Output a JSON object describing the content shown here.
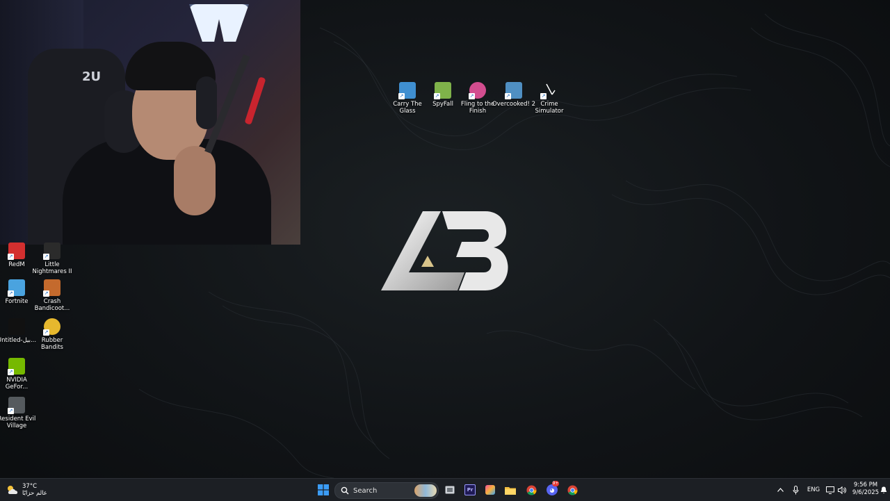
{
  "desktop": {
    "top_icons": [
      {
        "label": "Carry The Glass",
        "icon": "carry-the-glass-icon",
        "color": "#3f8fd1"
      },
      {
        "label": "SpyFall",
        "icon": "spyfall-icon",
        "color": "#7fb24a"
      },
      {
        "label": "Fling to the Finish",
        "icon": "fling-to-the-finish-icon",
        "color": "#d24d8f"
      },
      {
        "label": "Overcooked! 2",
        "icon": "overcooked-2-icon",
        "color": "#4f8fc2"
      },
      {
        "label": "Crime Simulator",
        "icon": "crime-simulator-icon",
        "color": "#1b1b1b"
      }
    ],
    "left_icons": [
      {
        "label": "RedM",
        "icon": "redm-icon",
        "color": "#d32f2f"
      },
      {
        "label": "Little Nightmares II",
        "icon": "little-nightmares-icon",
        "color": "#2b2b2b"
      },
      {
        "label": "Fortnite",
        "icon": "fortnite-icon",
        "color": "#4aa3df"
      },
      {
        "label": "Crash Bandicoot...",
        "icon": "crash-bandicoot-icon",
        "color": "#c46a2d"
      },
      {
        "label": "Untitled-بيل...",
        "icon": "untitled-file-icon",
        "color": "#111111"
      },
      {
        "label": "Rubber Bandits",
        "icon": "rubber-bandits-icon",
        "color": "#e6b82e"
      },
      {
        "label": "NVIDIA GeFor...",
        "icon": "nvidia-icon",
        "color": "#76b900"
      },
      {
        "label": "Resident Evil Village",
        "icon": "resident-evil-icon",
        "color": "#555a5e"
      }
    ],
    "chair_logo": "2U"
  },
  "taskbar": {
    "weather": {
      "temp": "37°C",
      "desc": "عالم حزابًا",
      "icon": "weather-partly-cloudy-icon"
    },
    "search_label": "Search",
    "language": "ENG",
    "time": "9:56 PM",
    "date": "9/6/2025",
    "discord_badge": "9+",
    "colors": {
      "taskbar_bg": "#1c1f24",
      "windows_blue": "#3b9cf5"
    }
  }
}
